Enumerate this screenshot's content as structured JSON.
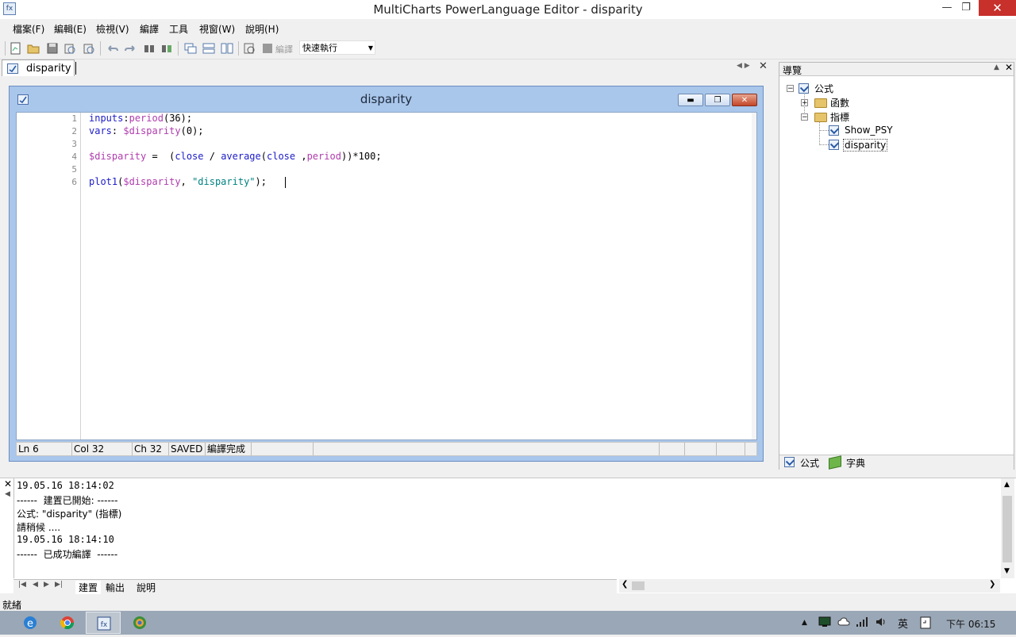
{
  "window": {
    "title": "MultiCharts PowerLanguage Editor - disparity"
  },
  "menu": [
    "檔案(F)",
    "編輯(E)",
    "檢視(V)",
    "編譯",
    "工具",
    "視窗(W)",
    "說明(H)"
  ],
  "toolbar": {
    "compile_label": "編譯",
    "quick_run": "快速執行"
  },
  "doc_tab": {
    "label": "disparity"
  },
  "editor": {
    "title": "disparity",
    "line_numbers": [
      "1",
      "2",
      "3",
      "4",
      "5",
      "6"
    ],
    "status": {
      "ln": "Ln 6",
      "col": "Col 32",
      "ch": "Ch 32",
      "saved": "SAVED",
      "compile": "編譯完成"
    }
  },
  "navigator": {
    "title": "導覽",
    "root": "公式",
    "functions": "函數",
    "indicators": "指標",
    "items": [
      "Show_PSY",
      "disparity"
    ],
    "tab_formula": "公式",
    "tab_dictionary": "字典"
  },
  "output": {
    "lines": [
      "19.05.16 18:14:02",
      "------  建置已開始: ------",
      "公式: \"disparity\" (指標)",
      "請稍候 ....",
      "19.05.16 18:14:10",
      "------  已成功編譯  ------"
    ],
    "tabs": [
      "建置",
      "輸出",
      "說明"
    ]
  },
  "app_status": "就緒",
  "taskbar": {
    "ime": "英",
    "clock": "下午 06:15"
  },
  "colors": {
    "keyword": "#1c1cc8",
    "variable": "#b03cae",
    "string": "#008080",
    "mdi_title": "#a9c6eb"
  }
}
